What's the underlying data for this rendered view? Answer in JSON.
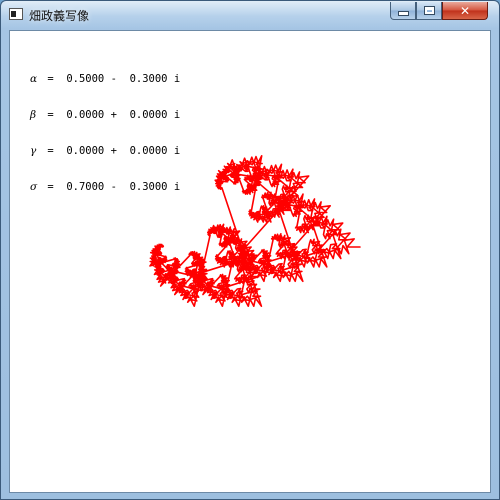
{
  "window": {
    "title": "畑政義写像",
    "controls": {
      "minimize": "minimize-button",
      "maximize": "maximize-button",
      "close": "close-button"
    }
  },
  "parameters": [
    {
      "symbol": "α",
      "equals": "=",
      "real": "0.5000",
      "sign": "-",
      "imag": "0.3000",
      "unit": "i"
    },
    {
      "symbol": "β",
      "equals": "=",
      "real": "0.0000",
      "sign": "+",
      "imag": "0.0000",
      "unit": "i"
    },
    {
      "symbol": "γ",
      "equals": "=",
      "real": "0.0000",
      "sign": "+",
      "imag": "0.0000",
      "unit": "i"
    },
    {
      "symbol": "σ",
      "equals": "=",
      "real": "0.7000",
      "sign": "-",
      "imag": "0.3000",
      "unit": "i"
    }
  ],
  "fractal": {
    "color": "#ff0000",
    "alpha": [
      0.5,
      -0.3
    ],
    "beta": [
      0.0,
      0.0
    ],
    "gamma": [
      0.0,
      0.0
    ],
    "delta": [
      0.7,
      -0.3
    ]
  },
  "colors": {
    "client_background": "#ffffff",
    "fractal": "#ff0000"
  }
}
